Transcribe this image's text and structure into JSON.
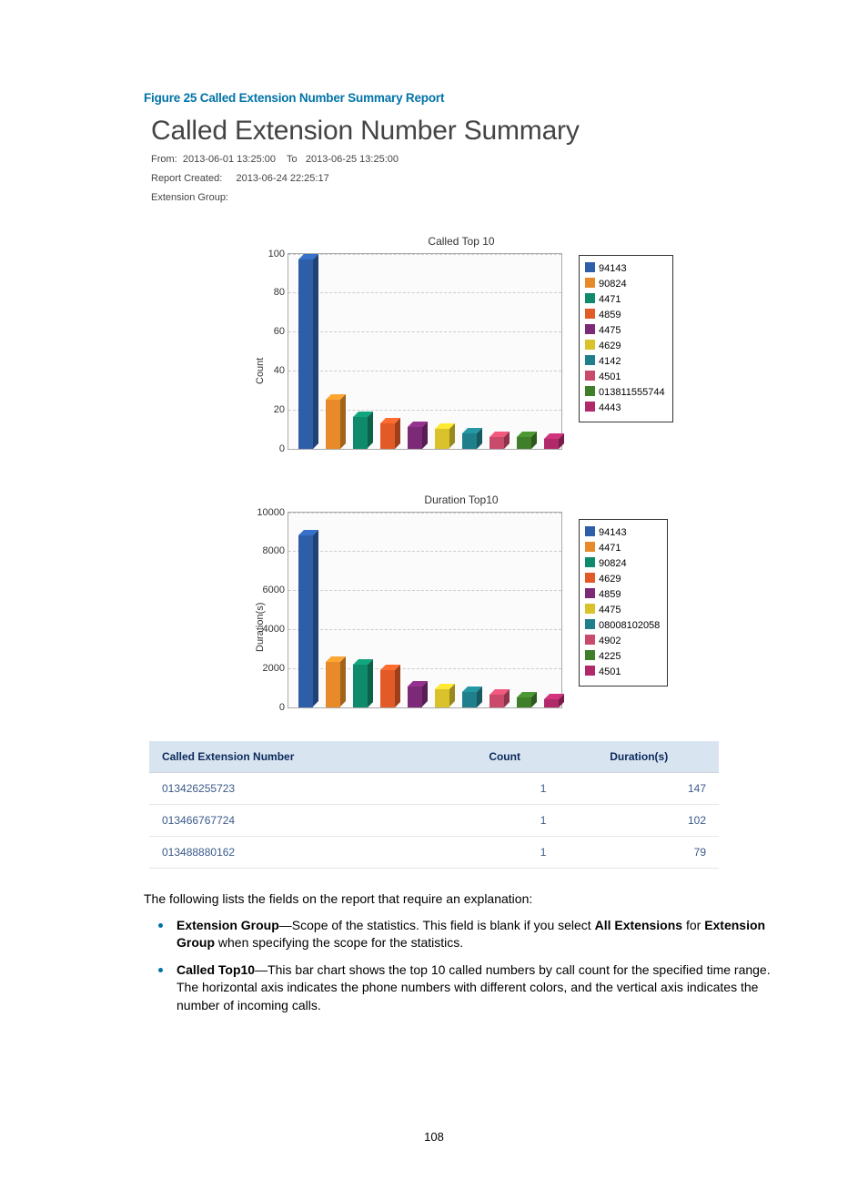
{
  "figureCaption": "Figure 25 Called Extension Number Summary Report",
  "report": {
    "title": "Called Extension Number Summary",
    "fromLabel": "From:",
    "fromVal": "2013-06-01 13:25:00",
    "toLabel": "To",
    "toVal": "2013-06-25 13:25:00",
    "createdLabel": "Report Created:",
    "createdVal": "2013-06-24 22:25:17",
    "extGroupLabel": "Extension Group:",
    "extGroupVal": ""
  },
  "chart_data": [
    {
      "type": "bar",
      "title": "Called Top 10",
      "ylabel": "Count",
      "xlabel": "",
      "ylim": [
        0,
        100
      ],
      "yticks": [
        0,
        20,
        40,
        60,
        80,
        100
      ],
      "categories": [
        "94143",
        "90824",
        "4471",
        "4859",
        "4475",
        "4629",
        "4142",
        "4501",
        "013811555744",
        "4443"
      ],
      "values": [
        97,
        25,
        16,
        13,
        11,
        10,
        8,
        6,
        6,
        5
      ],
      "colors": [
        "#2f5ea8",
        "#e78a2a",
        "#0f8a6a",
        "#e25a28",
        "#7c2a78",
        "#d9c22a",
        "#1f7f8a",
        "#c94a6a",
        "#3f7f2a",
        "#b02a6a"
      ]
    },
    {
      "type": "bar",
      "title": "Duration Top10",
      "ylabel": "Duration(s)",
      "xlabel": "",
      "ylim": [
        0,
        10000
      ],
      "yticks": [
        0,
        2000,
        4000,
        6000,
        8000,
        10000
      ],
      "categories": [
        "94143",
        "4471",
        "90824",
        "4629",
        "4859",
        "4475",
        "08008102058",
        "4902",
        "4225",
        "4501"
      ],
      "values": [
        8800,
        2300,
        2200,
        1900,
        1050,
        900,
        800,
        650,
        500,
        400
      ],
      "colors": [
        "#2f5ea8",
        "#e78a2a",
        "#0f8a6a",
        "#e25a28",
        "#7c2a78",
        "#d9c22a",
        "#1f7f8a",
        "#c94a6a",
        "#3f7f2a",
        "#b02a6a"
      ]
    }
  ],
  "table": {
    "headers": [
      "Called Extension Number",
      "Count",
      "Duration(s)"
    ],
    "rows": [
      {
        "ext": "013426255723",
        "count": 1,
        "dur": 147
      },
      {
        "ext": "013466767724",
        "count": 1,
        "dur": 102
      },
      {
        "ext": "013488880162",
        "count": 1,
        "dur": 79
      }
    ]
  },
  "explain": {
    "intro": "The following lists the fields on the report that require an explanation:",
    "items": [
      {
        "term": "Extension Group",
        "after": "—Scope of the statistics. This field is blank if you select ",
        "bold2": "All Extensions",
        "mid": " for ",
        "bold3": "Extension Group",
        "tail": " when specifying the scope for the statistics."
      },
      {
        "term": "Called Top10",
        "after": "—This bar chart shows the top 10 called numbers by call count for the specified time range. The horizontal axis indicates the phone numbers with different colors, and the vertical axis indicates the number of incoming calls."
      }
    ]
  },
  "pageNumber": "108"
}
